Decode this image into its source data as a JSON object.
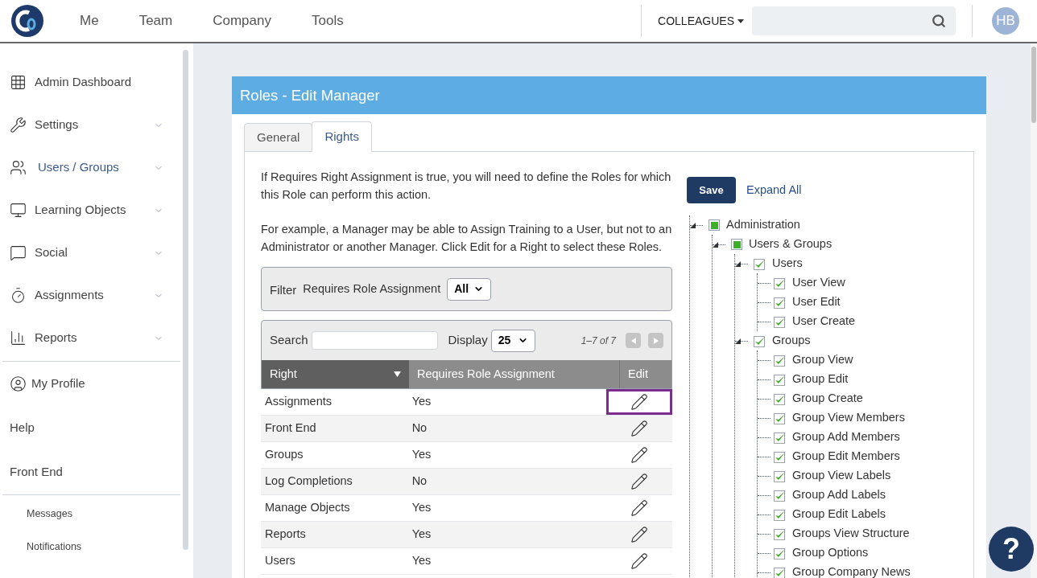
{
  "topbar": {
    "nav": [
      "Me",
      "Team",
      "Company",
      "Tools"
    ],
    "colleagues": "COLLEAGUES",
    "avatar": "HB"
  },
  "sidebar": {
    "items": [
      {
        "label": "Admin Dashboard",
        "selected": false,
        "expandable": false
      },
      {
        "label": "Settings",
        "selected": false,
        "expandable": true
      },
      {
        "label": "Users / Groups",
        "selected": true,
        "expandable": true
      },
      {
        "label": "Learning Objects",
        "selected": false,
        "expandable": true
      },
      {
        "label": "Social",
        "selected": false,
        "expandable": true
      },
      {
        "label": "Assignments",
        "selected": false,
        "expandable": true
      },
      {
        "label": "Reports",
        "selected": false,
        "expandable": true
      }
    ],
    "links": [
      {
        "label": "My Profile"
      },
      {
        "label": "Help"
      },
      {
        "label": "Front End"
      }
    ],
    "small_links": [
      "Messages",
      "Notifications"
    ]
  },
  "card": {
    "title": "Roles - Edit Manager",
    "tabs": [
      {
        "label": "General",
        "selected": false
      },
      {
        "label": "Rights",
        "selected": true
      }
    ],
    "intro": [
      "If Requires Right Assignment is true, you will need to define the Roles for which this Role can perform this action.",
      "For example, a Manager may be able to Assign Training to a User, but not to an Administrator or another Manager. Click Edit for a Right to select these Roles."
    ],
    "filter": {
      "label": "Filter",
      "field_label": "Requires Role Assignment",
      "value": "All"
    },
    "table": {
      "search_label": "Search",
      "display_label": "Display",
      "display_value": "25",
      "range": "1–7 of 7",
      "columns": [
        "Right",
        "Requires Role Assignment",
        "Edit"
      ],
      "rows": [
        {
          "right": "Assignments",
          "requires": "Yes",
          "highlighted": true
        },
        {
          "right": "Front End",
          "requires": "No",
          "highlighted": false
        },
        {
          "right": "Groups",
          "requires": "Yes",
          "highlighted": false
        },
        {
          "right": "Log Completions",
          "requires": "No",
          "highlighted": false
        },
        {
          "right": "Manage Objects",
          "requires": "Yes",
          "highlighted": false
        },
        {
          "right": "Reports",
          "requires": "Yes",
          "highlighted": false
        },
        {
          "right": "Users",
          "requires": "Yes",
          "highlighted": false
        }
      ]
    },
    "save": "Save",
    "expand_all": "Expand All",
    "tree": [
      {
        "label": "Administration",
        "kind": "partial",
        "children": [
          {
            "label": "Users & Groups",
            "kind": "partial",
            "children": [
              {
                "label": "Users",
                "kind": "checked",
                "children": [
                  {
                    "label": "User View",
                    "kind": "checked"
                  },
                  {
                    "label": "User Edit",
                    "kind": "checked"
                  },
                  {
                    "label": "User Create",
                    "kind": "checked"
                  }
                ]
              },
              {
                "label": "Groups",
                "kind": "checked",
                "children": [
                  {
                    "label": "Group View",
                    "kind": "checked"
                  },
                  {
                    "label": "Group Edit",
                    "kind": "checked"
                  },
                  {
                    "label": "Group Create",
                    "kind": "checked"
                  },
                  {
                    "label": "Group View Members",
                    "kind": "checked"
                  },
                  {
                    "label": "Group Add Members",
                    "kind": "checked"
                  },
                  {
                    "label": "Group Edit Members",
                    "kind": "checked"
                  },
                  {
                    "label": "Group View Labels",
                    "kind": "checked"
                  },
                  {
                    "label": "Group Add Labels",
                    "kind": "checked"
                  },
                  {
                    "label": "Group Edit Labels",
                    "kind": "checked"
                  },
                  {
                    "label": "Groups View Structure",
                    "kind": "checked"
                  },
                  {
                    "label": "Group Options",
                    "kind": "checked"
                  },
                  {
                    "label": "Group Company News",
                    "kind": "checked"
                  }
                ]
              }
            ]
          }
        ]
      }
    ]
  },
  "help": "?"
}
